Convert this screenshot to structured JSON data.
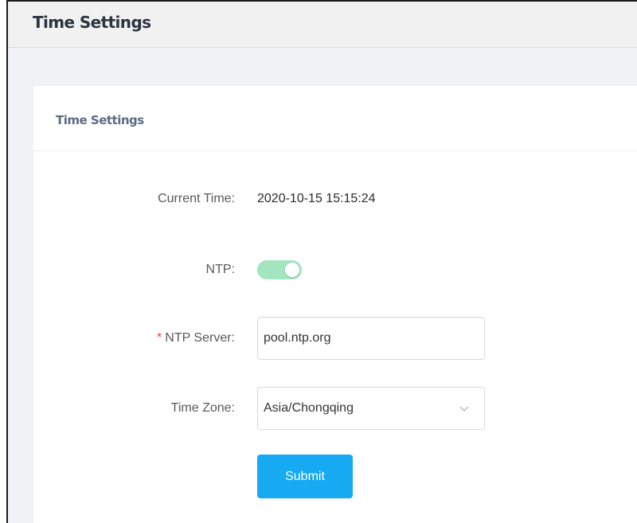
{
  "page": {
    "title": "Time Settings"
  },
  "card": {
    "title": "Time Settings"
  },
  "form": {
    "current_time": {
      "label": "Current Time:",
      "value": "2020-10-15 15:15:24"
    },
    "ntp": {
      "label": "NTP:",
      "enabled": true
    },
    "ntp_server": {
      "required_mark": "*",
      "label": "NTP Server:",
      "value": "pool.ntp.org"
    },
    "time_zone": {
      "label": "Time Zone:",
      "selected": "Asia/Chongqing"
    },
    "submit_label": "Submit"
  },
  "colors": {
    "accent": "#16aaf2",
    "toggle_on": "#a3e5bf",
    "required": "#e8453c"
  },
  "icons": {
    "select_arrow": "chevron-down-icon"
  }
}
